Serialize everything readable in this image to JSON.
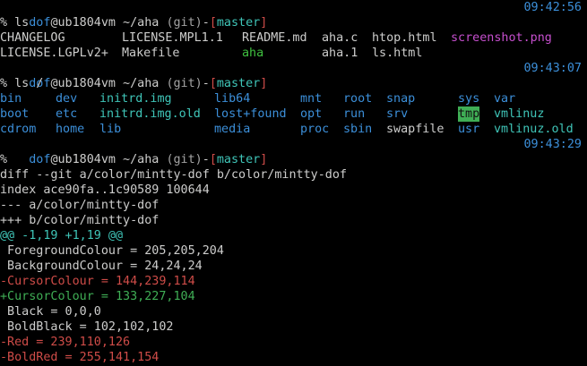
{
  "prompt1": {
    "user": "dof",
    "host": "@ub1804vm",
    "path": " ~/aha ",
    "git": "(git)",
    "dash": "-",
    "lbr": "[",
    "branch": "master",
    "rbr": "]",
    "time": "09:42:56"
  },
  "cmd1": "% ls",
  "ls": {
    "row1": [
      "CHANGELOG",
      "LICENSE.MPL1.1",
      "README.md",
      "aha.c",
      "htop.html",
      "screenshot.png"
    ],
    "row2": [
      "LICENSE.LGPLv2+",
      "Makefile",
      "aha",
      "aha.1",
      "ls.html"
    ]
  },
  "prompt2": {
    "user": "dof",
    "host": "@ub1804vm",
    "path": " ~/aha ",
    "git": "(git)",
    "dash": "-",
    "lbr": "[",
    "branch": "master",
    "rbr": "]",
    "time": "09:43:07"
  },
  "cmd2": "% ls /",
  "lsroot": {
    "row1": [
      "bin",
      "dev",
      "initrd.img",
      "lib64",
      "mnt",
      "root",
      "snap",
      "sys",
      "var"
    ],
    "row2": [
      "boot",
      "etc",
      "initrd.img.old",
      "lost+found",
      "opt",
      "run",
      "srv",
      "tmp",
      "vmlinuz"
    ],
    "row3": [
      "cdrom",
      "home",
      "lib",
      "media",
      "proc",
      "sbin",
      "swapfile",
      "usr",
      "vmlinuz.old"
    ]
  },
  "prompt3": {
    "user": "dof",
    "host": "@ub1804vm",
    "path": " ~/aha ",
    "git": "(git)",
    "dash": "-",
    "lbr": "[",
    "branch": "master",
    "rbr": "]",
    "time": "09:43:29"
  },
  "cmd3": "%",
  "diff": [
    "diff --git a/color/mintty-dof b/color/mintty-dof",
    "index ace90fa..1c90589 100644",
    "--- a/color/mintty-dof",
    "+++ b/color/mintty-dof",
    "@@ -1,19 +1,19 @@",
    " ForegroundColour = 205,205,204",
    " BackgroundColour = 24,24,24",
    "-CursorColour = 144,239,114",
    "+CursorColour = 133,227,104",
    " Black = 0,0,0",
    " BoldBlack = 102,102,102",
    "-Red = 239,110,126",
    "-BoldRed = 255,141,154"
  ],
  "colors": {
    "background": "#000000",
    "foreground": "#cdcdcc",
    "user": "#3c8fd9",
    "bracket": "#cf4c48",
    "branch": "#3fc5b8",
    "png": "#c64fce",
    "executable": "#3fc13f",
    "directory": "#3c8fd9",
    "symlink": "#3fc5b8",
    "deleted": "#cf4c48",
    "added": "#3fae55",
    "timestamp": "#3c8fd9"
  }
}
